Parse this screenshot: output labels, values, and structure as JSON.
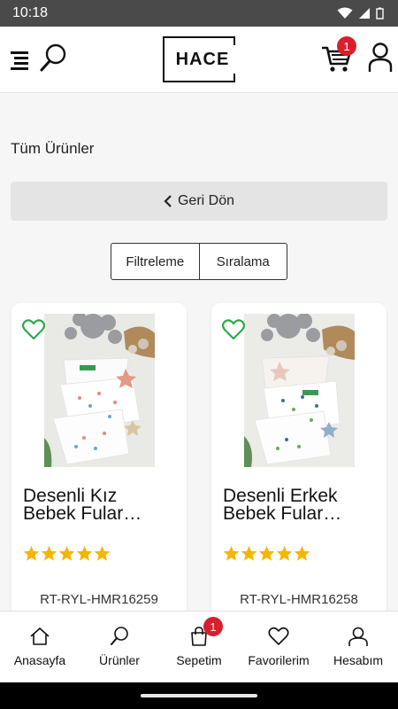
{
  "status_bar": {
    "time": "10:18"
  },
  "header": {
    "logo_text": "HACE",
    "cart_badge": "1"
  },
  "page": {
    "title": "Tüm Ürünler",
    "back_label": "Geri Dön"
  },
  "controls": {
    "filter_label": "Filtreleme",
    "sort_label": "Sıralama"
  },
  "products": [
    {
      "name": "Desenli Kız Bebek Fular…",
      "sku": "RT-RYL-HMR16259",
      "rating": 5
    },
    {
      "name": "Desenli Erkek Bebek Fular…",
      "sku": "RT-RYL-HMR16258",
      "rating": 5
    }
  ],
  "bottom_nav": {
    "items": [
      {
        "label": "Anasayfa",
        "icon": "home-icon"
      },
      {
        "label": "Ürünler",
        "icon": "search-icon"
      },
      {
        "label": "Sepetim",
        "icon": "bag-icon",
        "badge": "1"
      },
      {
        "label": "Favorilerim",
        "icon": "heart-icon"
      },
      {
        "label": "Hesabım",
        "icon": "user-icon"
      }
    ]
  },
  "colors": {
    "accent_green": "#2ea84a",
    "badge_red": "#d6202e",
    "star_yellow": "#f7b500"
  }
}
